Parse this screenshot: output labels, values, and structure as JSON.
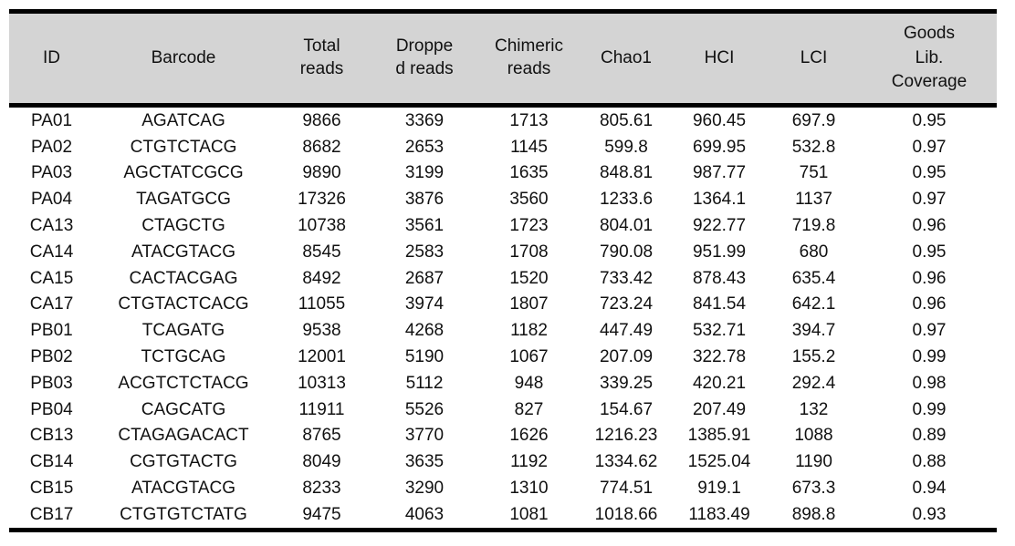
{
  "table": {
    "columns": [
      {
        "key": "id",
        "label": "ID",
        "class": "col-id"
      },
      {
        "key": "barcode",
        "label": "Barcode",
        "class": "col-barcode"
      },
      {
        "key": "total",
        "label": "Total\nreads",
        "class": "col-total"
      },
      {
        "key": "dropped",
        "label": "Droppe\nd  reads",
        "class": "col-dropped"
      },
      {
        "key": "chimeric",
        "label": "Chimeric\nreads",
        "class": "col-chimeric"
      },
      {
        "key": "chao1",
        "label": "Chao1",
        "class": "col-chao1"
      },
      {
        "key": "hci",
        "label": "HCI",
        "class": "col-hci"
      },
      {
        "key": "lci",
        "label": "LCI",
        "class": "col-lci"
      },
      {
        "key": "goods",
        "label": "Goods\nLib.\nCoverage",
        "class": "col-goods"
      }
    ],
    "rows": [
      [
        "PA01",
        "AGATCAG",
        "9866",
        "3369",
        "1713",
        "805.61",
        "960.45",
        "697.9",
        "0.95"
      ],
      [
        "PA02",
        "CTGTCTACG",
        "8682",
        "2653",
        "1145",
        "599.8",
        "699.95",
        "532.8",
        "0.97"
      ],
      [
        "PA03",
        "AGCTATCGCG",
        "9890",
        "3199",
        "1635",
        "848.81",
        "987.77",
        "751",
        "0.95"
      ],
      [
        "PA04",
        "TAGATGCG",
        "17326",
        "3876",
        "3560",
        "1233.6",
        "1364.1",
        "1137",
        "0.97"
      ],
      [
        "CA13",
        "CTAGCTG",
        "10738",
        "3561",
        "1723",
        "804.01",
        "922.77",
        "719.8",
        "0.96"
      ],
      [
        "CA14",
        "ATACGTACG",
        "8545",
        "2583",
        "1708",
        "790.08",
        "951.99",
        "680",
        "0.95"
      ],
      [
        "CA15",
        "CACTACGAG",
        "8492",
        "2687",
        "1520",
        "733.42",
        "878.43",
        "635.4",
        "0.96"
      ],
      [
        "CA17",
        "CTGTACTCACG",
        "11055",
        "3974",
        "1807",
        "723.24",
        "841.54",
        "642.1",
        "0.96"
      ],
      [
        "PB01",
        "TCAGATG",
        "9538",
        "4268",
        "1182",
        "447.49",
        "532.71",
        "394.7",
        "0.97"
      ],
      [
        "PB02",
        "TCTGCAG",
        "12001",
        "5190",
        "1067",
        "207.09",
        "322.78",
        "155.2",
        "0.99"
      ],
      [
        "PB03",
        "ACGTCTCTACG",
        "10313",
        "5112",
        "948",
        "339.25",
        "420.21",
        "292.4",
        "0.98"
      ],
      [
        "PB04",
        "CAGCATG",
        "11911",
        "5526",
        "827",
        "154.67",
        "207.49",
        "132",
        "0.99"
      ],
      [
        "CB13",
        "CTAGAGACACT",
        "8765",
        "3770",
        "1626",
        "1216.23",
        "1385.91",
        "1088",
        "0.89"
      ],
      [
        "CB14",
        "CGTGTACTG",
        "8049",
        "3635",
        "1192",
        "1334.62",
        "1525.04",
        "1190",
        "0.88"
      ],
      [
        "CB15",
        "ATACGTACG",
        "8233",
        "3290",
        "1310",
        "774.51",
        "919.1",
        "673.3",
        "0.94"
      ],
      [
        "CB17",
        "CTGTGTCTATG",
        "9475",
        "4063",
        "1081",
        "1018.66",
        "1183.49",
        "898.8",
        "0.93"
      ]
    ]
  },
  "style": {
    "header_background": "#d4d4d4",
    "rule_color": "#000000",
    "text_color": "#111111",
    "body_background": "#ffffff"
  }
}
